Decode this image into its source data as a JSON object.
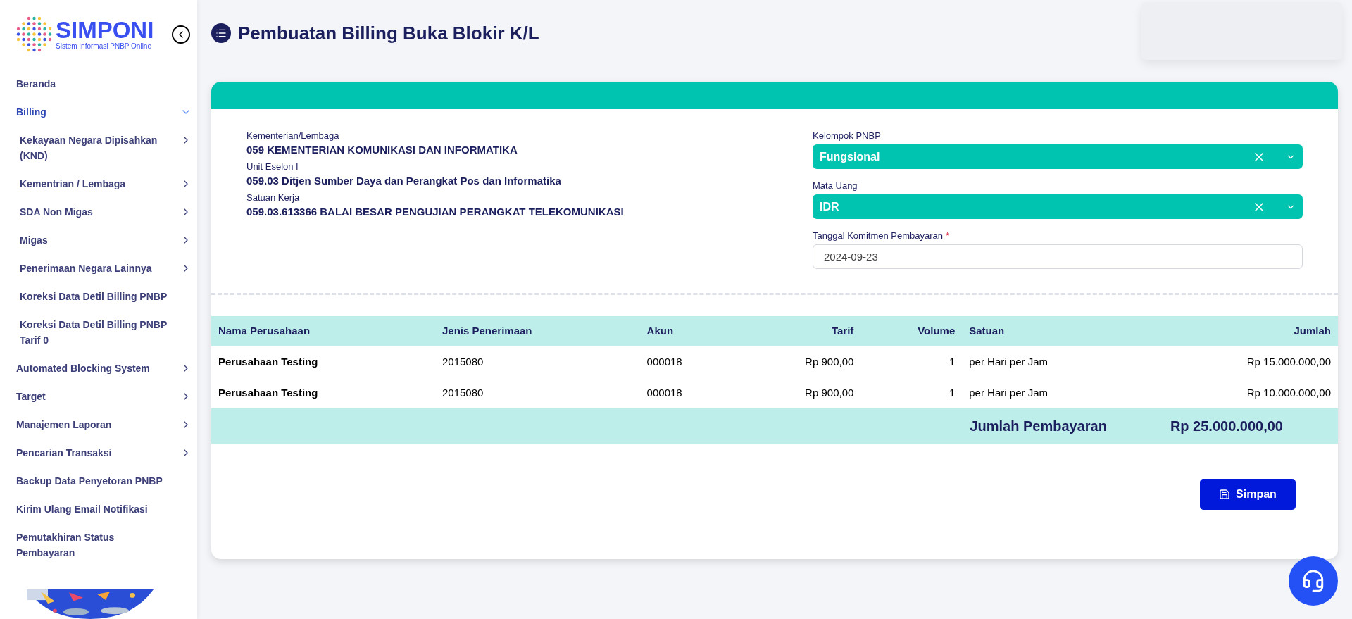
{
  "logo": {
    "name": "SIMPONI",
    "tagline": "Sistem Informasi PNBP Online"
  },
  "sidebar": {
    "items": [
      {
        "label": "Beranda",
        "kind": "link"
      },
      {
        "label": "Billing",
        "kind": "submenu",
        "expanded": true,
        "children": [
          {
            "label": "Kekayaan Negara Dipisahkan (KND)",
            "kind": "submenu",
            "expanded": false
          },
          {
            "label": "Kementrian / Lembaga",
            "kind": "submenu",
            "expanded": false
          },
          {
            "label": "SDA Non Migas",
            "kind": "submenu",
            "expanded": false
          },
          {
            "label": "Migas",
            "kind": "submenu",
            "expanded": false
          },
          {
            "label": "Penerimaan Negara Lainnya",
            "kind": "submenu",
            "expanded": false
          },
          {
            "label": "Koreksi Data Detil Billing PNBP",
            "kind": "link"
          },
          {
            "label": "Koreksi Data Detil Billing PNBP Tarif 0",
            "kind": "link"
          }
        ]
      },
      {
        "label": "Automated Blocking System",
        "kind": "submenu",
        "expanded": false
      },
      {
        "label": "Target",
        "kind": "submenu",
        "expanded": false
      },
      {
        "label": "Manajemen Laporan",
        "kind": "submenu",
        "expanded": false
      },
      {
        "label": "Pencarian Transaksi",
        "kind": "submenu",
        "expanded": false
      },
      {
        "label": "Backup Data Penyetoran PNBP",
        "kind": "link"
      },
      {
        "label": "Kirim Ulang Email Notifikasi",
        "kind": "link"
      },
      {
        "label": "Pemutakhiran Status Pembayaran",
        "kind": "link"
      }
    ]
  },
  "page_title": "Pembuatan Billing Buka Blokir K/L",
  "info": [
    {
      "label": "Kementerian/Lembaga",
      "value": "059 KEMENTERIAN KOMUNIKASI DAN INFORMATIKA"
    },
    {
      "label": "Unit Eselon I",
      "value": "059.03 Ditjen Sumber Daya dan Perangkat Pos dan Informatika"
    },
    {
      "label": "Satuan Kerja",
      "value": "059.03.613366 BALAI BESAR PENGUJIAN PERANGKAT TELEKOMUNIKASI"
    }
  ],
  "fields": [
    {
      "kind": "select",
      "label": "Kelompok PNBP",
      "value": "Fungsional"
    },
    {
      "kind": "select",
      "label": "Mata Uang",
      "value": "IDR"
    },
    {
      "kind": "date",
      "label": "Tanggal Komitmen Pembayaran",
      "value": "2024-09-23",
      "required_mark": "*"
    }
  ],
  "table": {
    "columns": [
      {
        "label": "Nama Perusahaan",
        "kind": "text"
      },
      {
        "label": "Jenis Penerimaan",
        "kind": "text"
      },
      {
        "label": "Akun",
        "kind": "text"
      },
      {
        "label": "Tarif",
        "kind": "number"
      },
      {
        "label": "Volume",
        "kind": "number"
      },
      {
        "label": "Satuan",
        "kind": "text"
      },
      {
        "label": "Jumlah",
        "kind": "number"
      }
    ],
    "rows": [
      [
        "Perusahaan Testing",
        "2015080",
        "000018",
        "Rp 900,00",
        "1",
        "per Hari per Jam",
        "Rp 15.000.000,00"
      ],
      [
        "Perusahaan Testing",
        "2015080",
        "000018",
        "Rp 900,00",
        "1",
        "per Hari per Jam",
        "Rp 10.000.000,00"
      ]
    ],
    "total_label": "Jumlah Pembayaran",
    "total_value": "Rp 25.000.000,00"
  },
  "save_button": "Simpan"
}
